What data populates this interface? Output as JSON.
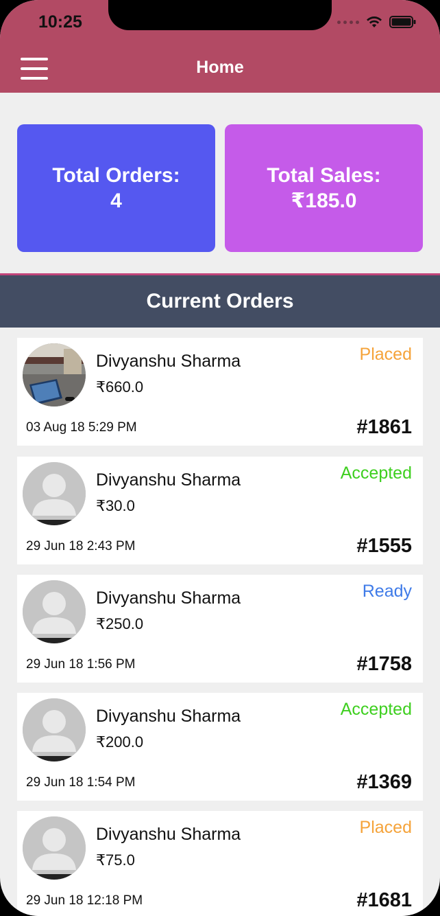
{
  "status_bar": {
    "time": "10:25"
  },
  "header": {
    "title": "Home"
  },
  "stats": {
    "orders_label": "Total Orders:",
    "orders_value": "4",
    "sales_label": "Total Sales:",
    "sales_value": "₹185.0"
  },
  "section": {
    "title": "Current Orders"
  },
  "orders": [
    {
      "name": "Divyanshu Sharma",
      "amount": "₹660.0",
      "status": "Placed",
      "date": "03 Aug 18 5:29 PM",
      "number": "#1861"
    },
    {
      "name": "Divyanshu Sharma",
      "amount": "₹30.0",
      "status": "Accepted",
      "date": "29 Jun 18 2:43 PM",
      "number": "#1555"
    },
    {
      "name": "Divyanshu Sharma",
      "amount": "₹250.0",
      "status": "Ready",
      "date": "29 Jun 18 1:56 PM",
      "number": "#1758"
    },
    {
      "name": "Divyanshu Sharma",
      "amount": "₹200.0",
      "status": "Accepted",
      "date": "29 Jun 18 1:54 PM",
      "number": "#1369"
    },
    {
      "name": "Divyanshu Sharma",
      "amount": "₹75.0",
      "status": "Placed",
      "date": "29 Jun 18 12:18 PM",
      "number": "#1681"
    }
  ],
  "colors": {
    "header": "#b24a64",
    "orders_card": "#5558f0",
    "sales_card": "#c55be9",
    "section_header": "#434d63",
    "status_placed": "#f5a33a",
    "status_accepted": "#3ecf1f",
    "status_ready": "#3f7be8"
  },
  "icons": {
    "menu": "hamburger-icon",
    "wifi": "wifi-icon",
    "battery": "battery-icon",
    "avatar_photo": "user-photo-avatar",
    "avatar_placeholder": "user-placeholder-icon"
  }
}
